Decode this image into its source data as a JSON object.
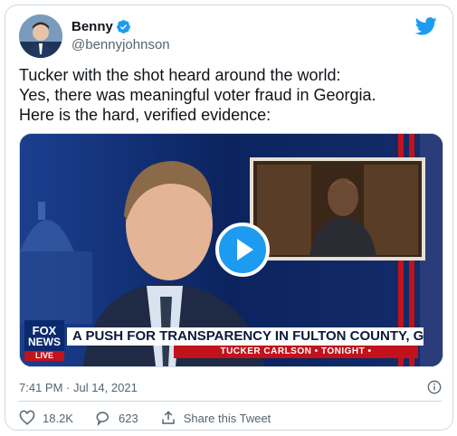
{
  "author": {
    "name": "Benny",
    "handle": "@bennyjohnson",
    "verified": true
  },
  "tweet": {
    "lines": [
      "Tucker with the shot heard around the world:",
      "Yes, there was meaningful voter fraud in Georgia.",
      "Here is the hard, verified evidence:"
    ],
    "timestamp": "7:41 PM · Jul 14, 2021"
  },
  "media": {
    "network_lines": [
      "FOX",
      "NEWS",
      "LIVE"
    ],
    "chyron": "A PUSH FOR TRANSPARENCY IN FULTON COUNTY, GEORGIA",
    "subchyron": "TUCKER CARLSON • TONIGHT •"
  },
  "actions": {
    "likes": "18.2K",
    "replies": "623",
    "share_label": "Share this Tweet"
  },
  "colors": {
    "accent": "#1d9bf0",
    "text": "#0f1419",
    "muted": "#536471",
    "border": "#cfd9de"
  }
}
